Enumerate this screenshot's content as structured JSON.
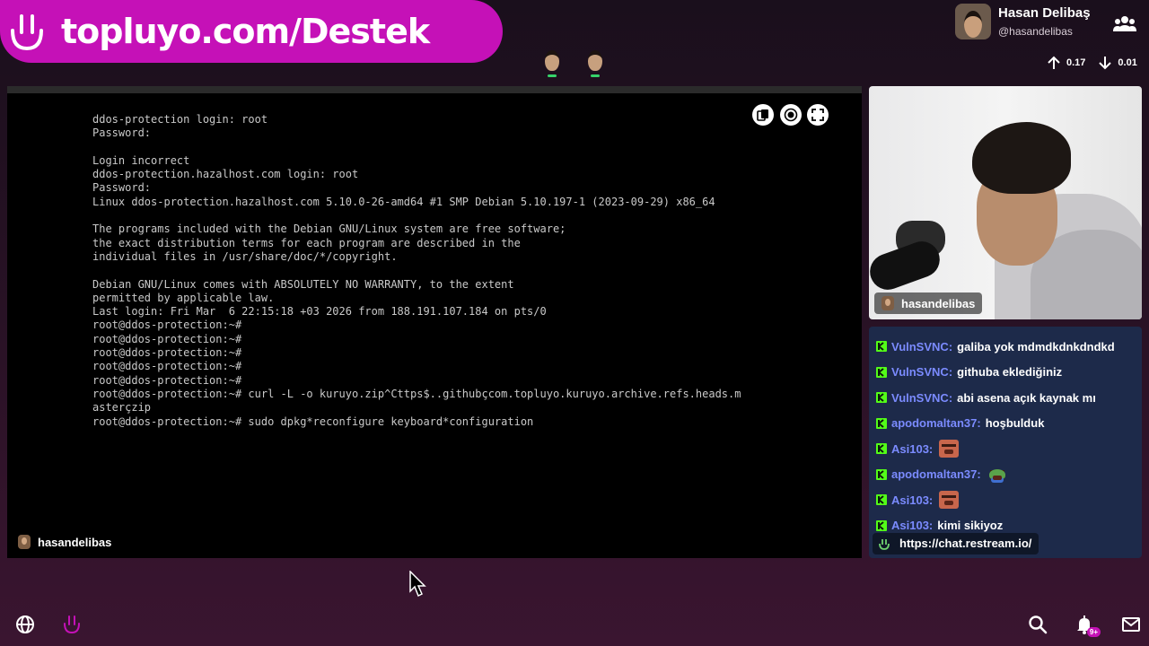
{
  "banner": {
    "text": "topluyo.com/Destek"
  },
  "profile": {
    "name": "Hasan Delibaş",
    "handle": "@hasandelibas"
  },
  "stats": {
    "up": "0.17",
    "down": "0.01"
  },
  "terminal": {
    "lines": [
      "ddos-protection login: root",
      "Password:",
      "",
      "Login incorrect",
      "ddos-protection.hazalhost.com login: root",
      "Password:",
      "Linux ddos-protection.hazalhost.com 5.10.0-26-amd64 #1 SMP Debian 5.10.197-1 (2023-09-29) x86_64",
      "",
      "The programs included with the Debian GNU/Linux system are free software;",
      "the exact distribution terms for each program are described in the",
      "individual files in /usr/share/doc/*/copyright.",
      "",
      "Debian GNU/Linux comes with ABSOLUTELY NO WARRANTY, to the extent",
      "permitted by applicable law.",
      "Last login: Fri Mar  6 22:15:18 +03 2026 from 188.191.107.184 on pts/0",
      "root@ddos-protection:~#",
      "root@ddos-protection:~#",
      "root@ddos-protection:~#",
      "root@ddos-protection:~#",
      "root@ddos-protection:~#",
      "root@ddos-protection:~# curl -L -o kuruyo.zip^Cttps$..githubçcom.topluyo.kuruyo.archive.refs.heads.m",
      "asterçzip",
      "root@ddos-protection:~# sudo dpkg*reconfigure keyboard*configuration"
    ],
    "streamer_tag": "hasandelibas"
  },
  "cam": {
    "streamer_tag": "hasandelibas"
  },
  "chat": {
    "messages": [
      {
        "user": "VulnSVNC",
        "text": "galiba yok mdmdkdnkdndkd",
        "emote": ""
      },
      {
        "user": "VulnSVNC",
        "text": "githuba eklediğiniz",
        "emote": ""
      },
      {
        "user": "VulnSVNC",
        "text": "abi asena açık kaynak mı",
        "emote": ""
      },
      {
        "user": "apodomaltan37",
        "text": "hoşbulduk",
        "emote": ""
      },
      {
        "user": "Asi103",
        "text": "",
        "emote": "angry-face"
      },
      {
        "user": "apodomaltan37",
        "text": "",
        "emote": "pepe"
      },
      {
        "user": "Asi103",
        "text": "",
        "emote": "angry-face"
      },
      {
        "user": "Asi103",
        "text": "kimi sikiyoz",
        "emote": ""
      }
    ],
    "link": "https://chat.restream.io/"
  },
  "notifications": {
    "badge": "9+"
  },
  "colors": {
    "brand": "#c511b7",
    "chat_bg": "#1d2a4a",
    "username": "#7b8bff",
    "kick_green": "#53fc18"
  }
}
